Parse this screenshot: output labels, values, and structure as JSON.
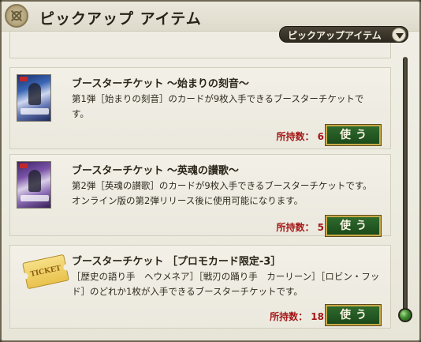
{
  "window": {
    "title": "ピックアップ アイテム"
  },
  "filter": {
    "selected": "ピックアップアイテム"
  },
  "items": [
    {
      "title": "ブースターチケット ～始まりの刻音～",
      "description": "第1弾［始まりの刻音］のカードが9枚入手できるブースターチケットです。",
      "quantity": "所持数： 6",
      "use_label": "使う"
    },
    {
      "title": "ブースターチケット ～英魂の讃歌～",
      "description": "第2弾［英魂の讃歌］のカードが9枚入手できるブースターチケットです。オンライン版の第2弾リリース後に使用可能になります。",
      "quantity": "所持数： 5",
      "use_label": "使う"
    },
    {
      "title": "ブースターチケット ［プロモカード限定-3］",
      "description": "［歴史の語り手　ヘウメネア］［戦刃の踊り手　カーリーン］［ロビン・フッド］のどれか1枚が入手できるブースターチケットです。",
      "quantity": "所持数： 18",
      "use_label": "使う",
      "ticket_text": "TICKET"
    }
  ],
  "colors": {
    "quantity": "#a31717",
    "button": "#1b4a1a",
    "button_border": "#c9a948"
  }
}
